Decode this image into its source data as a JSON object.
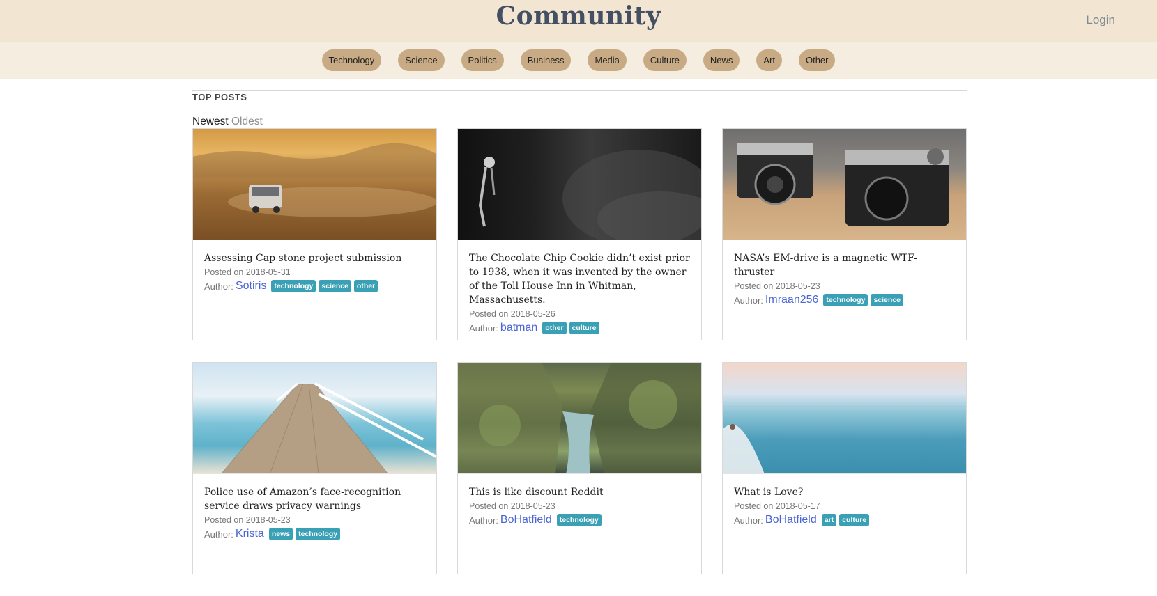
{
  "header": {
    "brand": "Community",
    "login_label": "Login"
  },
  "categories": [
    "Technology",
    "Science",
    "Politics",
    "Business",
    "Media",
    "Culture",
    "News",
    "Art",
    "Other"
  ],
  "main": {
    "section_title": "TOP POSTS",
    "sort_newest": "Newest",
    "sort_oldest": "Oldest"
  },
  "posts": [
    {
      "title": "Assessing Cap stone project submission",
      "date": "Posted on 2018-05-31",
      "author_label": "Author:",
      "author": "Sotiris",
      "tags": [
        "technology",
        "science",
        "other"
      ]
    },
    {
      "title": "The Chocolate Chip Cookie didn’t exist prior to 1938, when it was invented by the owner of the Toll House Inn in Whitman, Massachusetts.",
      "date": "Posted on 2018-05-26",
      "author_label": "Author:",
      "author": "batman",
      "tags": [
        "other",
        "culture"
      ]
    },
    {
      "title": "NASA’s EM-drive is a magnetic WTF-thruster",
      "date": "Posted on 2018-05-23",
      "author_label": "Author:",
      "author": "Imraan256",
      "tags": [
        "technology",
        "science"
      ]
    },
    {
      "title": "Police use of Amazon’s face-recognition service draws privacy warnings",
      "date": "Posted on 2018-05-23",
      "author_label": "Author:",
      "author": "Krista",
      "tags": [
        "news",
        "technology"
      ]
    },
    {
      "title": "This is like discount Reddit",
      "date": "Posted on 2018-05-23",
      "author_label": "Author:",
      "author": "BoHatfield",
      "tags": [
        "technology"
      ]
    },
    {
      "title": "What is Love?",
      "date": "Posted on 2018-05-17",
      "author_label": "Author:",
      "author": "BoHatfield",
      "tags": [
        "art",
        "culture"
      ]
    }
  ],
  "colors": {
    "header_bg": "#f2e6d3",
    "category_pill": "#c8ab85",
    "tag_bg": "#3aa0b6",
    "author_link": "#4a66d4"
  }
}
